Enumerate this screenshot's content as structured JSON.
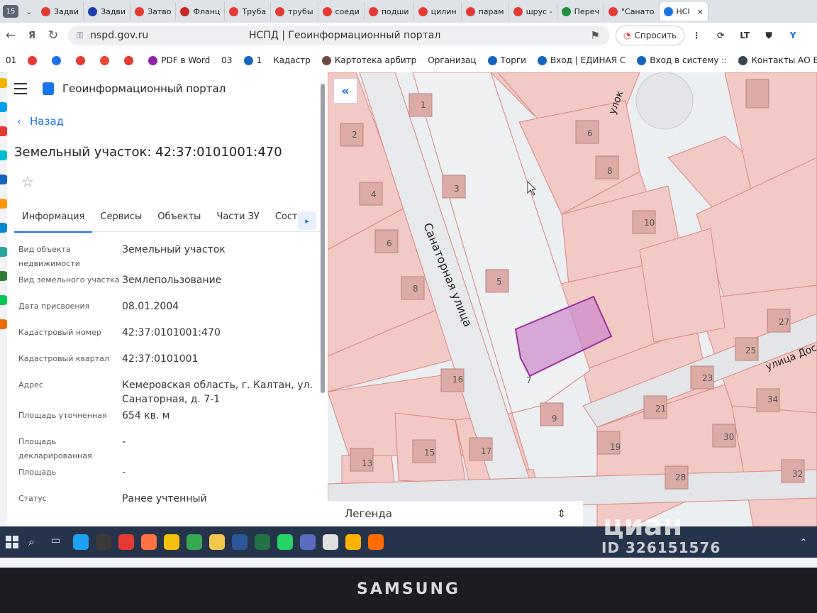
{
  "browser": {
    "tab_number": "15",
    "tabs": [
      {
        "label": "Задви",
        "color": "#e53935"
      },
      {
        "label": "Задви",
        "color": "#1e40af"
      },
      {
        "label": "Затво",
        "color": "#e53935"
      },
      {
        "label": "Фланц",
        "color": "#c62828"
      },
      {
        "label": "Труба",
        "color": "#e53935"
      },
      {
        "label": "трубы",
        "color": "#e53935"
      },
      {
        "label": "соеди",
        "color": "#e53935"
      },
      {
        "label": "подши",
        "color": "#e53935"
      },
      {
        "label": "цилин",
        "color": "#e53935"
      },
      {
        "label": "парам",
        "color": "#e53935"
      },
      {
        "label": "шрус -",
        "color": "#e53935"
      },
      {
        "label": "Переч",
        "color": "#1e8e3e"
      },
      {
        "label": "\"Санато",
        "color": "#e53935"
      },
      {
        "label": "НСІ",
        "color": "#1a73e8"
      }
    ],
    "url": "nspd.gov.ru",
    "page_title": "НСПД | Геоинформационный портал",
    "ask_button": "Спросить",
    "ext_lt": "LT",
    "bookmarks": [
      {
        "label": "01",
        "color": ""
      },
      {
        "label": "",
        "color": "#e53935"
      },
      {
        "label": "",
        "color": "#1a73e8"
      },
      {
        "label": "",
        "color": "#e53935"
      },
      {
        "label": "",
        "color": "#ea4335"
      },
      {
        "label": "",
        "color": "#e53935"
      },
      {
        "label": "PDF в Word",
        "color": "#8e24aa"
      },
      {
        "label": "03",
        "color": ""
      },
      {
        "label": "1",
        "color": "#1565c0"
      },
      {
        "label": "Кадастр",
        "color": ""
      },
      {
        "label": "Картотека арбитр",
        "color": "#6d4c41"
      },
      {
        "label": "Организац",
        "color": ""
      },
      {
        "label": "Торги",
        "color": "#1565c0"
      },
      {
        "label": "Вход | ЕДИНАЯ С",
        "color": "#1565c0"
      },
      {
        "label": "Вход в систему ::",
        "color": "#1565c0"
      },
      {
        "label": "Контакты АО ЕЭ",
        "color": "#37474f"
      }
    ]
  },
  "panel": {
    "app_title": "Геоинформационный портал",
    "back_label": "Назад",
    "object_title": "Земельный участок: 42:37:0101001:470",
    "star_icon": "☆",
    "tabs": [
      "Информация",
      "Сервисы",
      "Объекты",
      "Части ЗУ",
      "Соста"
    ],
    "rows": [
      {
        "label": "Вид объекта недвижимости",
        "value": "Земельный участок"
      },
      {
        "label": "Вид земельного участка",
        "value": "Землепользование"
      },
      {
        "label": "Дата присвоения",
        "value": "08.01.2004"
      },
      {
        "label": "Кадастровый номер",
        "value": "42:37:0101001:470"
      },
      {
        "label": "Кадастровый квартал",
        "value": "42:37:0101001"
      },
      {
        "label": "Адрес",
        "value": "Кемеровская область, г. Калтан, ул. Санаторная, д. 7-1"
      },
      {
        "label": "Площадь уточненная",
        "value": "654 кв. м"
      },
      {
        "label": "Площадь декларированная",
        "value": "-"
      },
      {
        "label": "Площадь",
        "value": "-"
      },
      {
        "label": "Статус",
        "value": "Ранее учтенный"
      }
    ]
  },
  "map": {
    "collapse_label": "«",
    "street_main": "Санаторная улица",
    "street_top": "улок",
    "street_right": "улица Дос",
    "legend_label": "Легенда",
    "legend_toggle": "⇕",
    "parcel_labels": [
      "1",
      "2",
      "3",
      "4",
      "5",
      "6",
      "7",
      "8",
      "6",
      "8",
      "10",
      "13",
      "15",
      "16",
      "17",
      "9",
      "19",
      "21",
      "23",
      "25",
      "27",
      "28",
      "30",
      "32",
      "34"
    ],
    "highlight_color": "#cc88cc"
  },
  "taskbar": {
    "icon_colors": [
      "#1da1f2",
      "#3a3a3a",
      "#e53935",
      "#ff7043",
      "#f4c20d",
      "#34a853",
      "#f2c94c",
      "#2b579a",
      "#217346",
      "#25d366",
      "#5c6bc0",
      "#e0e0e0",
      "#ffb300",
      "#ff6d00"
    ]
  },
  "overlay": {
    "watermark": "циан",
    "watermark_id": "ID 326151576",
    "bezel_brand": "SAMSUNG"
  }
}
